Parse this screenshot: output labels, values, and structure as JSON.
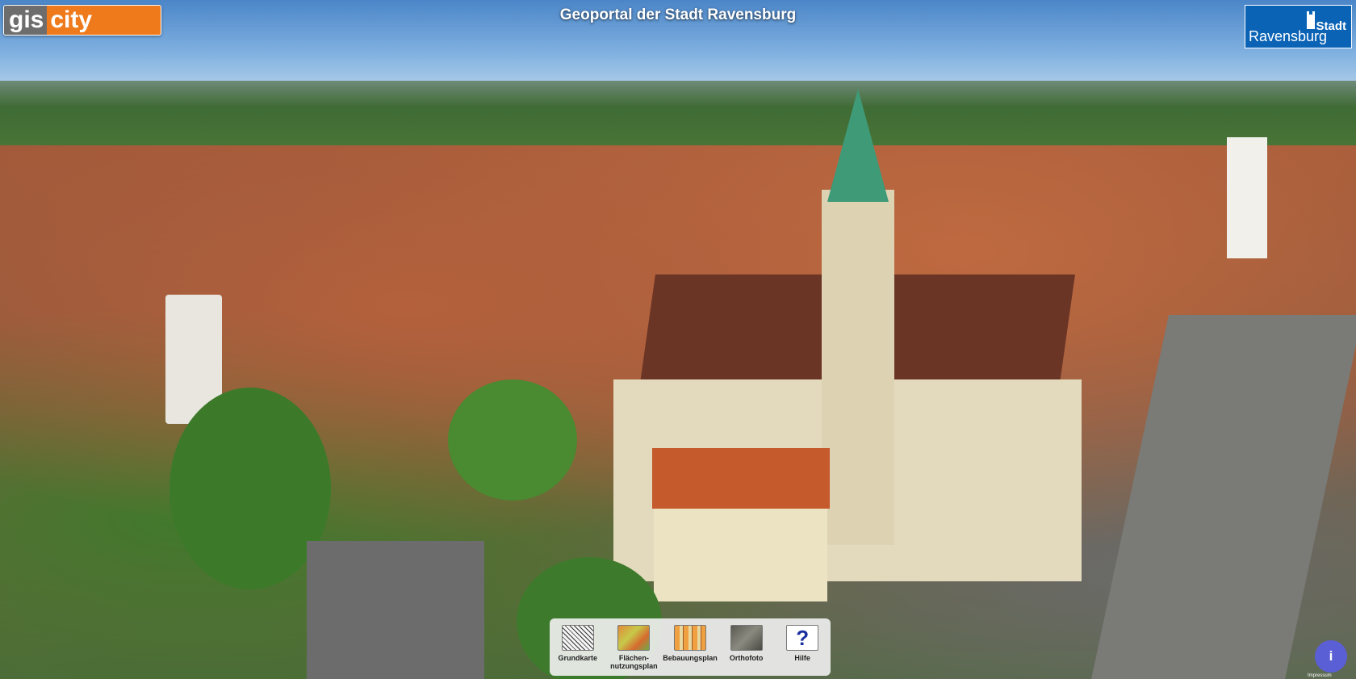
{
  "header": {
    "logo_left": {
      "part1": "gis",
      "part2": "city"
    },
    "title": "Geoportal der Stadt Ravensburg",
    "logo_right": {
      "line1": "Stadt",
      "line2": "Ravensburg"
    }
  },
  "toolbar": {
    "items": [
      {
        "label": "Grundkarte",
        "icon": "grundkarte-icon"
      },
      {
        "label": "Flächen-\nnutzungsplan",
        "icon": "flaechennutzungsplan-icon"
      },
      {
        "label": "Bebauungsplan",
        "icon": "bebauungsplan-icon"
      },
      {
        "label": "Orthofoto",
        "icon": "orthofoto-icon"
      },
      {
        "label": "Hilfe",
        "icon": "help-icon",
        "glyph": "?"
      }
    ]
  },
  "info_button": {
    "label": "i"
  },
  "footer": {
    "impressum": "Impressum"
  },
  "colors": {
    "gis_gray": "#6d6d6d",
    "gis_orange": "#ee7a1c",
    "stadt_blue": "#0a63b5",
    "info_purple": "#5b5fd6"
  }
}
